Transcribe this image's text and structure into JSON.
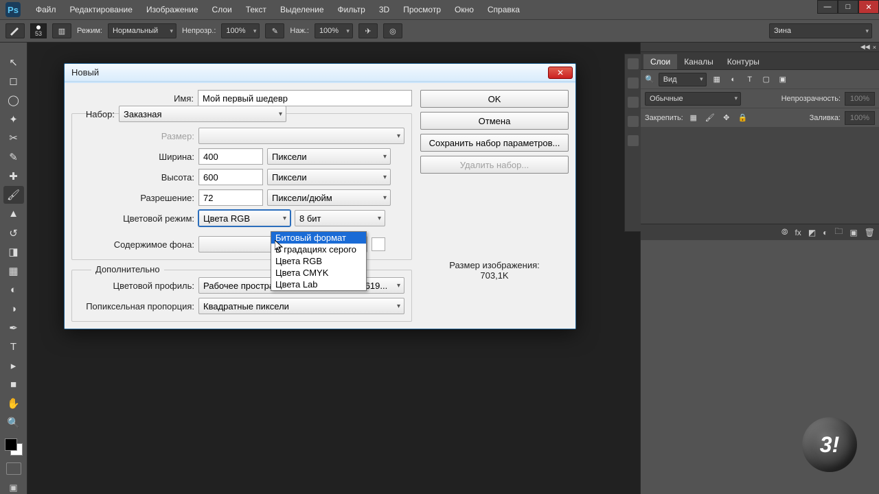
{
  "menubar": {
    "logo": "Ps",
    "items": [
      "Файл",
      "Редактирование",
      "Изображение",
      "Слои",
      "Текст",
      "Выделение",
      "Фильтр",
      "3D",
      "Просмотр",
      "Окно",
      "Справка"
    ]
  },
  "optionbar": {
    "brush_size": "53",
    "mode_label": "Режим:",
    "mode_value": "Нормальный",
    "opacity_label": "Непрозр.:",
    "opacity_value": "100%",
    "flow_label": "Наж.:",
    "flow_value": "100%",
    "presets_value": "Зина"
  },
  "right": {
    "tabs": [
      "Слои",
      "Каналы",
      "Контуры"
    ],
    "view_mode_label": "Вид",
    "blend_value": "Обычные",
    "opacity_label": "Непрозрачность:",
    "opacity_value": "100%",
    "lock_label": "Закрепить:",
    "fill_label": "Заливка:",
    "fill_value": "100%"
  },
  "dialog": {
    "title": "Новый",
    "name_label": "Имя:",
    "name_value": "Мой первый шедевр",
    "preset_label": "Набор:",
    "preset_value": "Заказная",
    "size_label": "Размер:",
    "width_label": "Ширина:",
    "width_value": "400",
    "width_unit": "Пиксели",
    "height_label": "Высота:",
    "height_value": "600",
    "height_unit": "Пиксели",
    "res_label": "Разрешение:",
    "res_value": "72",
    "res_unit": "Пиксели/дюйм",
    "color_mode_label": "Цветовой режим:",
    "color_mode_value": "Цвета RGB",
    "bit_depth_value": "8 бит",
    "bg_label": "Содержимое фона:",
    "advanced_title": "Дополнительно",
    "profile_label": "Цветовой профиль:",
    "profile_value": "Рабочее пространство RGB:  sRGB IEC619...",
    "aspect_label": "Попиксельная пропорция:",
    "aspect_value": "Квадратные пиксели",
    "ok_label": "OK",
    "cancel_label": "Отмена",
    "save_preset_label": "Сохранить набор параметров...",
    "delete_preset_label": "Удалить набор...",
    "img_size_label": "Размер изображения:",
    "img_size_value": "703,1K",
    "mode_options": [
      "Битовый формат",
      "В градациях серого",
      "Цвета RGB",
      "Цвета CMYK",
      "Цвета Lab"
    ]
  },
  "watermark": "3!"
}
